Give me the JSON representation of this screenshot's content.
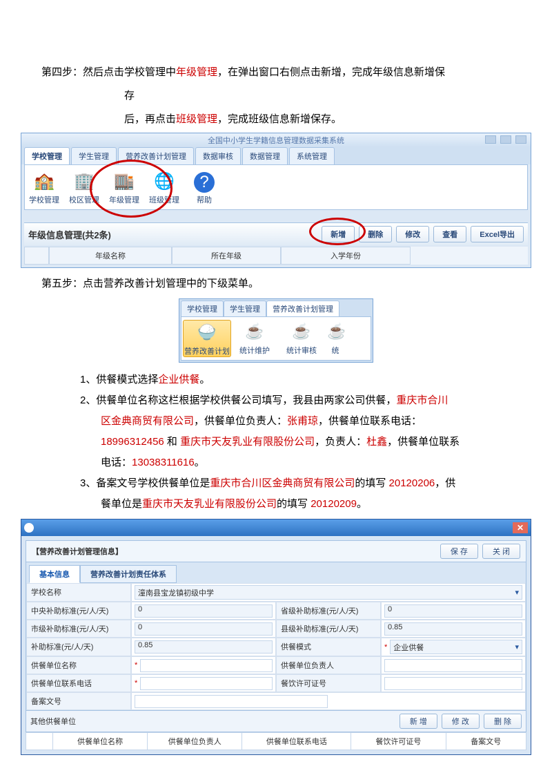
{
  "step4": {
    "prefix": "第四步：然后点击学校管理中",
    "red1": "年级管理",
    "mid": "，在弹出窗口右侧点击新增，完成年级信息新增保",
    "line2_pre": "存",
    "line3_pre": "后，再点击",
    "red2": "班级管理",
    "line3_post": "，完成班级信息新增保存。"
  },
  "shot1": {
    "title": "全国中小学生学籍信息管理数据采集系统",
    "tabs": [
      "学校管理",
      "学生管理",
      "营养改善计划管理",
      "数据审核",
      "数据管理",
      "系统管理"
    ],
    "ribbon": [
      "学校管理",
      "校区管理",
      "年级管理",
      "班级管理",
      "帮助"
    ],
    "band": "年级信息管理(共2条)",
    "btns": [
      "新增",
      "删除",
      "修改",
      "查看",
      "Excel导出"
    ],
    "cols": [
      "",
      "年级名称",
      "所在年级",
      "入学年份"
    ]
  },
  "step5": "第五步：点击营养改善计划管理中的下级菜单。",
  "shot2": {
    "tabs": [
      "学校管理",
      "学生管理",
      "营养改善计划管理"
    ],
    "items": [
      "营养改善计划",
      "统计维护",
      "统计审核",
      "统"
    ]
  },
  "list": {
    "i1_pre": "1、供餐模式选择",
    "i1_red": "企业供餐",
    "i1_post": "。",
    "i2_head": "2、供餐单位名称这栏根据学校供餐公司填写，我县由两家公司供餐，",
    "i2_r1": "重庆市合川",
    "i2_l2_r1": "区金典商贸有限公司",
    "i2_l2_mid": "，供餐单位负责人：",
    "i2_l2_r2": "张甫琼",
    "i2_l2_mid2": "，供餐单位联系电话：",
    "i2_l3_r1": "18996312456",
    "i2_l3_mid": " 和 ",
    "i2_l3_r2": "重庆市天友乳业有限股份公司",
    "i2_l3_mid2": "，负责人：",
    "i2_l3_r3": "杜鑫",
    "i2_l3_mid3": "，供餐单位联系",
    "i2_l4_pre": "电话：",
    "i2_l4_r1": "13038311616",
    "i2_l4_post": "。",
    "i3_pre": "3、备案文号学校供餐单位是",
    "i3_r1": "重庆市合川区金典商贸有限公司",
    "i3_mid": "的填写 ",
    "i3_r2": "20120206",
    "i3_post": "，供",
    "i3_l2_pre": "餐单位是",
    "i3_l2_r1": "重庆市天友乳业有限股份公司",
    "i3_l2_mid": "的填写 ",
    "i3_l2_r2": "20120209",
    "i3_l2_post": "。"
  },
  "shot3": {
    "panel_title": "【营养改善计划管理信息】",
    "save": "保 存",
    "close": "关 闭",
    "tabs": [
      "基本信息",
      "营养改善计划责任体系"
    ],
    "fields": {
      "school_label": "学校名称",
      "school_value": "潼南县宝龙镇初级中学",
      "c_sub_label": "中央补助标准(元/人/天)",
      "c_sub_value": "0",
      "p_sub_label": "省级补助标准(元/人/天)",
      "p_sub_value": "0",
      "city_sub_label": "市级补助标准(元/人/天)",
      "city_sub_value": "0",
      "county_sub_label": "县级补助标准(元/人/天)",
      "county_sub_value": "0.85",
      "sub_label": "补助标准(元/人/天)",
      "sub_value": "0.85",
      "mode_label": "供餐模式",
      "mode_value": "企业供餐",
      "unit_name_label": "供餐单位名称",
      "unit_owner_label": "供餐单位负责人",
      "unit_phone_label": "供餐单位联系电话",
      "cater_lic_label": "餐饮许可证号",
      "record_no_label": "备案文号"
    },
    "other_label": "其他供餐单位",
    "other_btns": [
      "新 增",
      "修 改",
      "删 除"
    ],
    "sub_cols": [
      "",
      "供餐单位名称",
      "供餐单位负责人",
      "供餐单位联系电话",
      "餐饮许可证号",
      "备案文号"
    ]
  }
}
